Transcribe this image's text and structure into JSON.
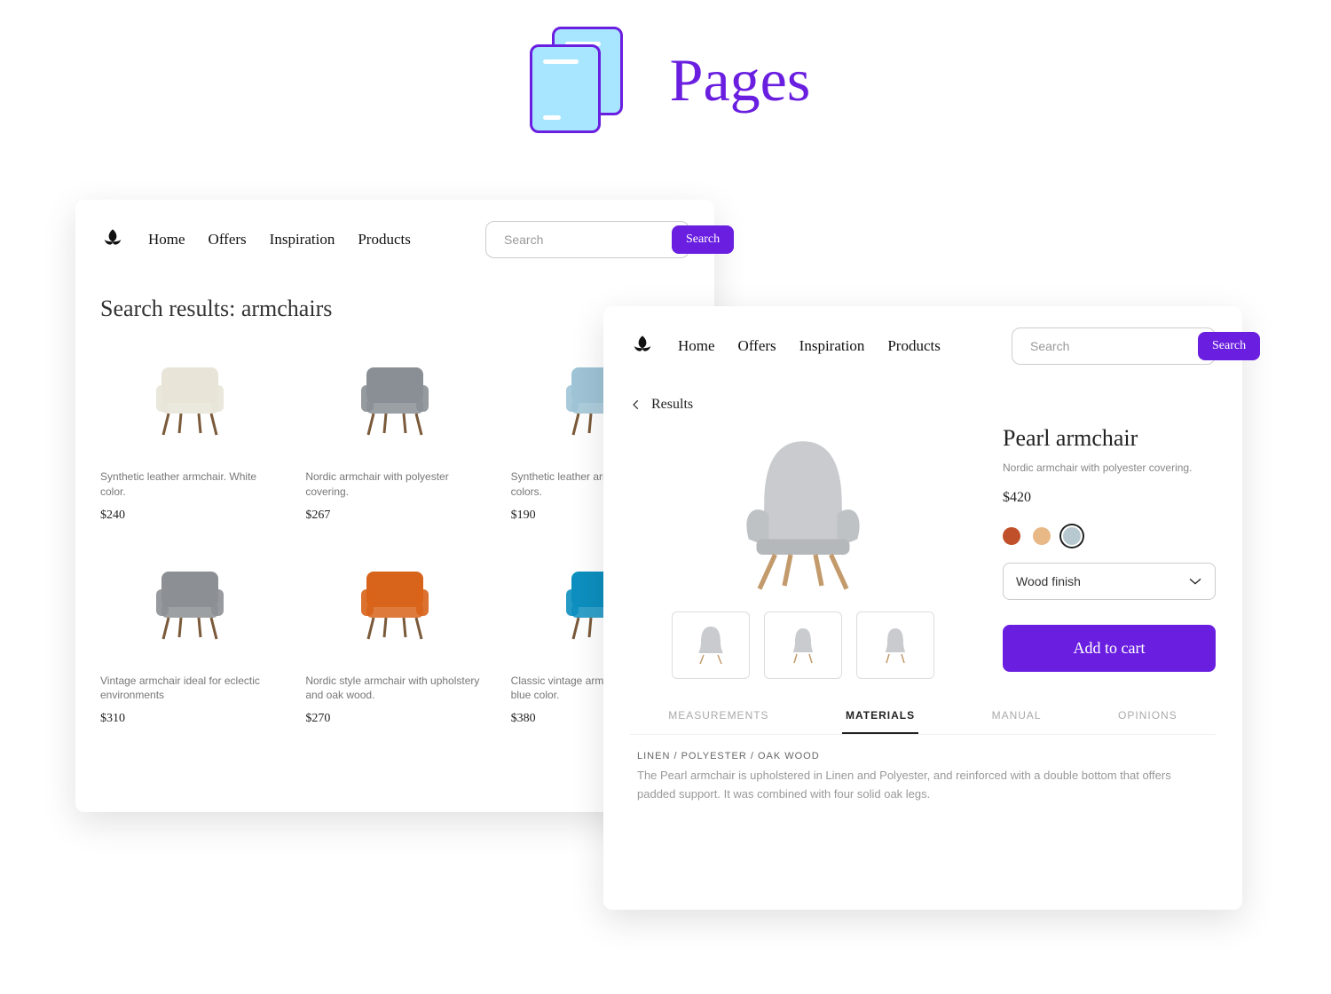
{
  "header": {
    "title": "Pages"
  },
  "nav": {
    "links": [
      "Home",
      "Offers",
      "Inspiration",
      "Products"
    ],
    "search_placeholder": "Search",
    "search_button": "Search"
  },
  "results": {
    "title": "Search results: armchairs",
    "items": [
      {
        "desc": "Synthetic leather armchair. White color.",
        "price": "$240",
        "color": "#e8e4d8"
      },
      {
        "desc": "Nordic armchair with polyester covering.",
        "price": "$267",
        "color": "#8a8f95"
      },
      {
        "desc": "Synthetic leather armchair. Various colors.",
        "price": "$190",
        "color": "#9fc4d6"
      },
      {
        "desc": "Vintage armchair ideal for eclectic environments",
        "price": "$310",
        "color": "#8c8f93"
      },
      {
        "desc": "Nordic style armchair with upholstery and oak wood.",
        "price": "$270",
        "color": "#d8631a"
      },
      {
        "desc": "Classic vintage armchair in electric blue color.",
        "price": "$380",
        "color": "#0d8fbf"
      }
    ]
  },
  "detail": {
    "back_label": "Results",
    "title": "Pearl armchair",
    "desc": "Nordic armchair with polyester covering.",
    "price": "$420",
    "swatches": [
      {
        "color": "#c0502a",
        "selected": false
      },
      {
        "color": "#e8b887",
        "selected": false
      },
      {
        "color": "#b8c8d0",
        "selected": true
      }
    ],
    "finish_label": "Wood finish",
    "add_label": "Add to cart",
    "tabs": [
      "MEASUREMENTS",
      "MATERIALS",
      "MANUAL",
      "OPINIONS"
    ],
    "active_tab": 1,
    "materials": {
      "tags": "LINEN  /  POLYESTER  /  OAK WOOD",
      "text": "The Pearl armchair is upholstered in Linen and Polyester, and reinforced with a double bottom that offers padded support. It was combined with four solid oak legs."
    }
  }
}
